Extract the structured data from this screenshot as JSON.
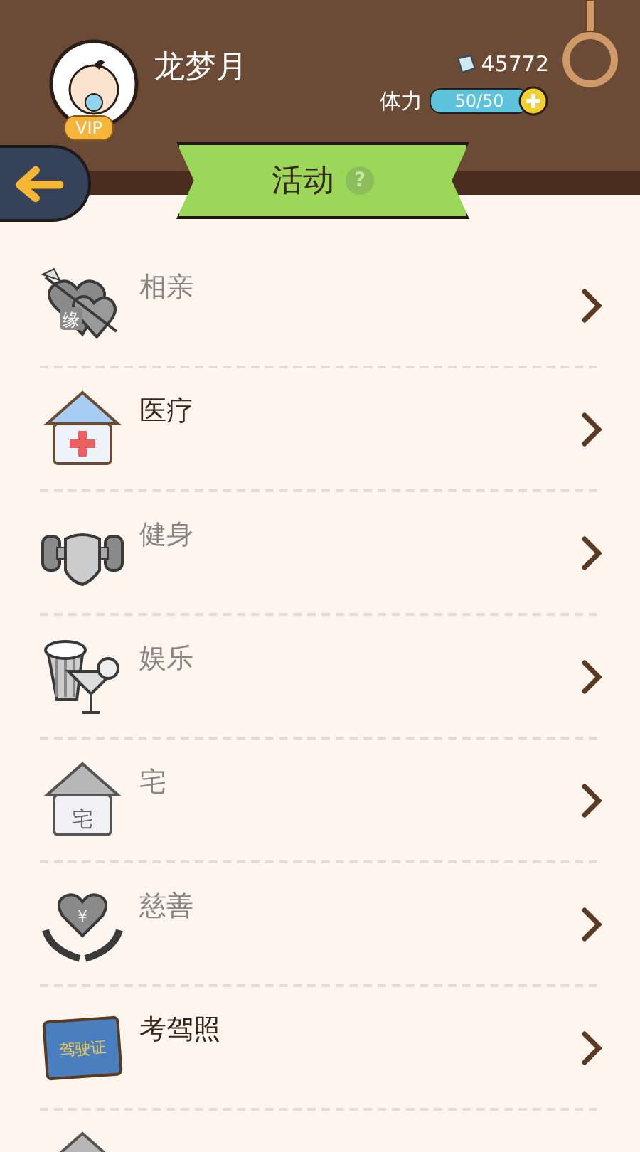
{
  "profile": {
    "name": "龙梦月",
    "badge": "VIP",
    "money": "45772",
    "stamina_label": "体力",
    "stamina": {
      "level": 1,
      "reading": "50/50"
    }
  },
  "title": {
    "text": "活动",
    "help": "?"
  },
  "items": [
    {
      "label": "相亲",
      "kind": "hearts",
      "icon_text": "缘",
      "enabled": false
    },
    {
      "label": "医疗",
      "kind": "hospital",
      "enabled": true
    },
    {
      "label": "健身",
      "kind": "dumbbell",
      "enabled": false
    },
    {
      "label": "娱乐",
      "kind": "drinks",
      "enabled": false
    },
    {
      "label": "宅",
      "kind": "house",
      "icon_text": "宅",
      "enabled": false
    },
    {
      "label": "慈善",
      "kind": "charity",
      "icon_text": "¥",
      "enabled": false
    },
    {
      "label": "考驾照",
      "kind": "license",
      "icon_text": "驾驶证",
      "enabled": true
    },
    {
      "kind": "roof"
    }
  ]
}
